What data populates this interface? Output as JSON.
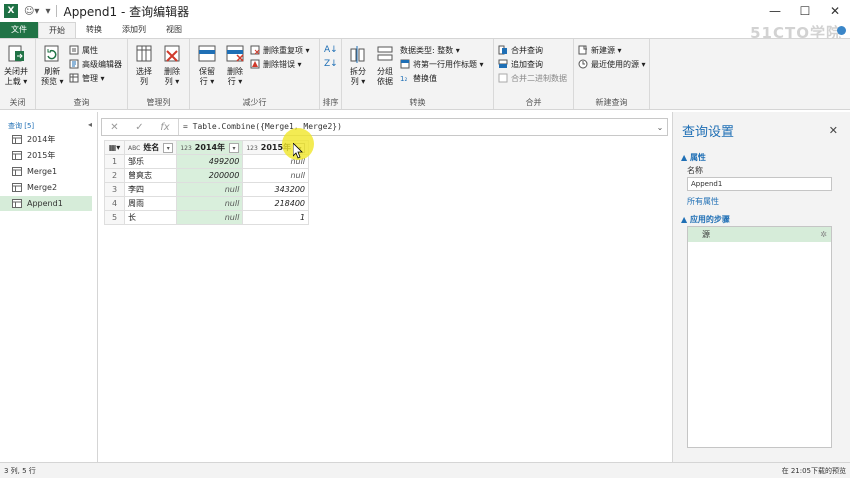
{
  "window": {
    "title": "Append1 - 查询编辑器",
    "app_icon": "X",
    "minimize": "—",
    "maximize": "☐",
    "close": "✕"
  },
  "tabs": [
    {
      "label": "文件"
    },
    {
      "label": "开始"
    },
    {
      "label": "转换"
    },
    {
      "label": "添加列"
    },
    {
      "label": "视图"
    }
  ],
  "watermark": "51CTO学院",
  "ribbon": {
    "close": {
      "btn": "关闭并\n上载 ▾",
      "label": "关闭"
    },
    "query": {
      "refresh": "刷新\n预览 ▾",
      "properties": "属性",
      "advanced_editor": "高级编辑器",
      "manage": "管理 ▾",
      "label": "查询"
    },
    "manage_cols": {
      "choose": "选择\n列",
      "remove": "删除\n列 ▾",
      "label": "管理列"
    },
    "reduce_rows": {
      "keep": "保留\n行 ▾",
      "remove": "删除\n行 ▾",
      "remove_dups": "删除重复项 ▾",
      "remove_errors": "删除错误 ▾",
      "label": "减少行"
    },
    "sort": {
      "label": "排序"
    },
    "transform": {
      "split": "拆分\n列 ▾",
      "group": "分组\n依据",
      "datatype": "数据类型: 整数 ▾",
      "first_row_header": "将第一行用作标题 ▾",
      "replace": "替换值",
      "label": "转换"
    },
    "combine": {
      "merge": "合并查询",
      "append": "追加查询",
      "combine_binaries": "合并二进制数据",
      "label": "合并"
    },
    "new_query": {
      "new_source": "新建源 ▾",
      "recent_sources": "最近使用的源 ▾",
      "label": "新建查询"
    }
  },
  "formula": "= Table.Combine({Merge1, Merge2})",
  "queries": {
    "header": "查询 [5]",
    "items": [
      {
        "name": "2014年",
        "selected": false
      },
      {
        "name": "2015年",
        "selected": false
      },
      {
        "name": "Merge1",
        "selected": false
      },
      {
        "name": "Merge2",
        "selected": false
      },
      {
        "name": "Append1",
        "selected": true
      }
    ]
  },
  "grid": {
    "columns": [
      {
        "type": "ABC",
        "name": "姓名"
      },
      {
        "type": "123",
        "name": "2014年"
      },
      {
        "type": "123",
        "name": "2015年"
      }
    ],
    "rows": [
      {
        "n": "1",
        "name": "邹乐",
        "y2014": "499200",
        "y2015": "null"
      },
      {
        "n": "2",
        "name": "曾爽志",
        "y2014": "200000",
        "y2015": "null"
      },
      {
        "n": "3",
        "name": "李四",
        "y2014": "null",
        "y2015": "343200"
      },
      {
        "n": "4",
        "name": "周雨",
        "y2014": "null",
        "y2015": "218400"
      },
      {
        "n": "5",
        "name": "长",
        "y2014": "null",
        "y2015": "1"
      }
    ]
  },
  "settings": {
    "title": "查询设置",
    "properties_header": "▲ 属性",
    "name_label": "名称",
    "name_value": "Append1",
    "all_properties": "所有属性",
    "steps_header": "▲ 应用的步骤",
    "steps": [
      {
        "name": "源"
      }
    ]
  },
  "status": {
    "left": "3 列, 5 行",
    "right": "在 21:05下载的预览"
  },
  "colors": {
    "accent_green": "#217346",
    "selection": "#d6ecd9",
    "link_blue": "#1f6fb5"
  }
}
